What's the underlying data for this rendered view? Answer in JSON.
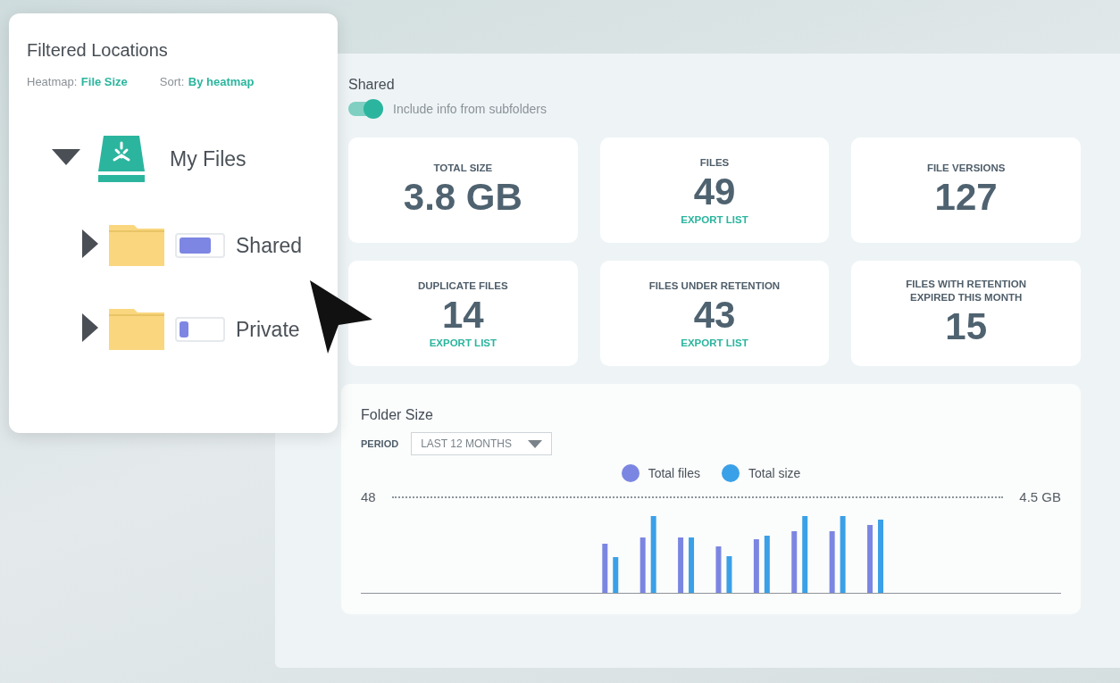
{
  "filter_panel": {
    "title": "Filtered Locations",
    "filters": [
      {
        "label": "Heatmap:",
        "value": "File Size"
      },
      {
        "label": "Sort:",
        "value": "By heatmap"
      }
    ],
    "tree": [
      {
        "label": "My Files",
        "kind": "drive",
        "expanded": true,
        "children": [
          {
            "label": "Shared",
            "kind": "folder",
            "expanded": false,
            "level": 0.75
          },
          {
            "label": "Private",
            "kind": "folder",
            "expanded": false,
            "level": 0.22
          }
        ]
      }
    ]
  },
  "details": {
    "title": "Shared",
    "subfolders_toggle": {
      "label": "Include info from subfolders",
      "on": true
    },
    "stats": [
      {
        "label": "TOTAL SIZE",
        "value": "3.8 GB"
      },
      {
        "label": "FILES",
        "value": "49",
        "action": "EXPORT LIST"
      },
      {
        "label": "FILE VERSIONS",
        "value": "127"
      },
      {
        "label": "DUPLICATE FILES",
        "value": "14",
        "action": "EXPORT LIST"
      },
      {
        "label": "FILES UNDER RETENTION",
        "value": "43",
        "action": "EXPORT LIST"
      },
      {
        "label": "FILES WITH RETENTION EXPIRED THIS MONTH",
        "value": "15"
      }
    ],
    "folder_size": {
      "title": "Folder Size",
      "period_label": "PERIOD",
      "period": "LAST 12 MONTHS",
      "legend": [
        {
          "label": "Total files",
          "color": "#7b86e2"
        },
        {
          "label": "Total size",
          "color": "#3aa0e8"
        }
      ],
      "left_max": "48",
      "right_max": "4.5 GB"
    }
  }
}
